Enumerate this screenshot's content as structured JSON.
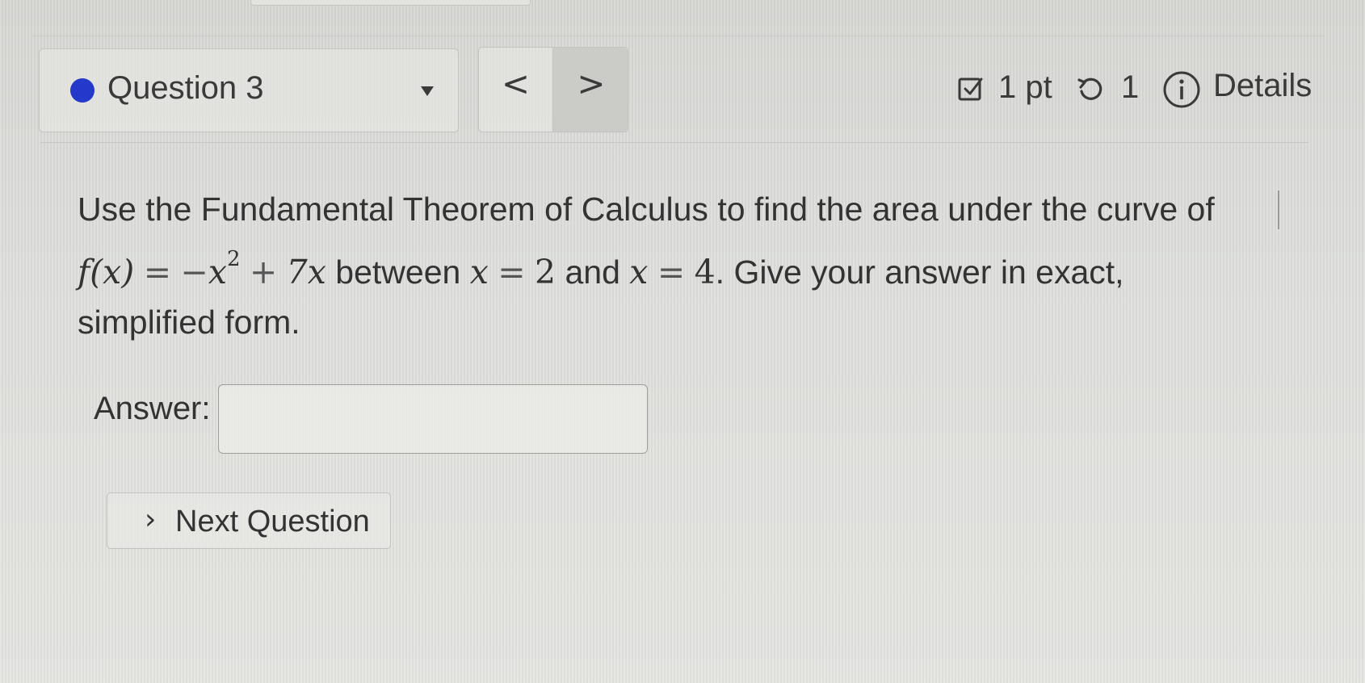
{
  "header": {
    "question_label": "Question 3",
    "status_color": "#2438c9",
    "prev_label": "<",
    "next_label": ">",
    "points": "1 pt",
    "retries": "1",
    "details_label": "Details",
    "icons": {
      "status": "status-dot-icon",
      "dropdown": "caret-down-icon",
      "points": "checkbox-icon",
      "retry": "retry-icon",
      "info": "info-icon"
    }
  },
  "question": {
    "line1": "Use the Fundamental Theorem of Calculus to find the area under the curve of",
    "fx": "f(x)",
    "eq": "=",
    "minus": "−",
    "x": "x",
    "exp": "2",
    "plus": "+",
    "seven_x": "7x",
    "between": " between ",
    "x_var_a": "x",
    "eq_a": "=",
    "lower": "2",
    "and": " and ",
    "x_var_b": "x",
    "eq_b": "=",
    "upper": "4",
    "tail": ". Give your answer in exact,",
    "line3": "simplified form."
  },
  "answer": {
    "label": "Answer:",
    "value": "",
    "placeholder": ""
  },
  "footer": {
    "next_chevron": "›",
    "next_question_label": "Next Question"
  }
}
